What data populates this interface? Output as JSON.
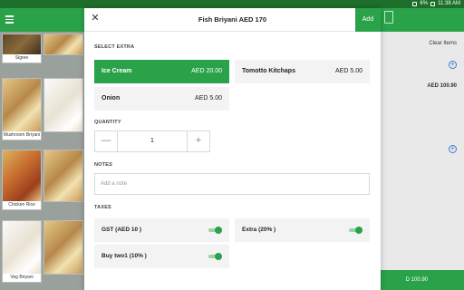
{
  "status_bar": {
    "time": "11:38 AM",
    "battery": "6%"
  },
  "grid": {
    "items": [
      {
        "label": "Sigree"
      },
      {
        "label": "Mushroom Briyani"
      },
      {
        "label": "Chicken Rice"
      },
      {
        "label": "Veg Briyani"
      }
    ]
  },
  "dialog": {
    "title": "Fish Briyani AED 170",
    "add_label": "Add",
    "close_icon": "close-icon",
    "select_extra_label": "SELECT EXTRA",
    "extras": [
      {
        "name": "Ice Cream",
        "price": "AED 20.00",
        "selected": true
      },
      {
        "name": "Tomotto Kitchaps",
        "price": "AED 5.00",
        "selected": false
      },
      {
        "name": "Onion",
        "price": "AED 5.00",
        "selected": false
      }
    ],
    "quantity_label": "QUANTITY",
    "quantity_value": "1",
    "minus_symbol": "—",
    "plus_symbol": "+",
    "notes_label": "NOTES",
    "notes_placeholder": "Add a note",
    "taxes_label": "TAXES",
    "taxes": [
      {
        "name": "GST (AED 10 )",
        "enabled": true
      },
      {
        "name": "Extra (20% )",
        "enabled": true
      },
      {
        "name": "Buy two1 (10% )",
        "enabled": true
      }
    ]
  },
  "right_panel": {
    "clear_items_label": "Clear Items",
    "amount": "AED 100.90",
    "charge_amount": "D 100.90"
  },
  "colors": {
    "accent": "#2aa24a",
    "status_bar": "#1e6e2b"
  }
}
